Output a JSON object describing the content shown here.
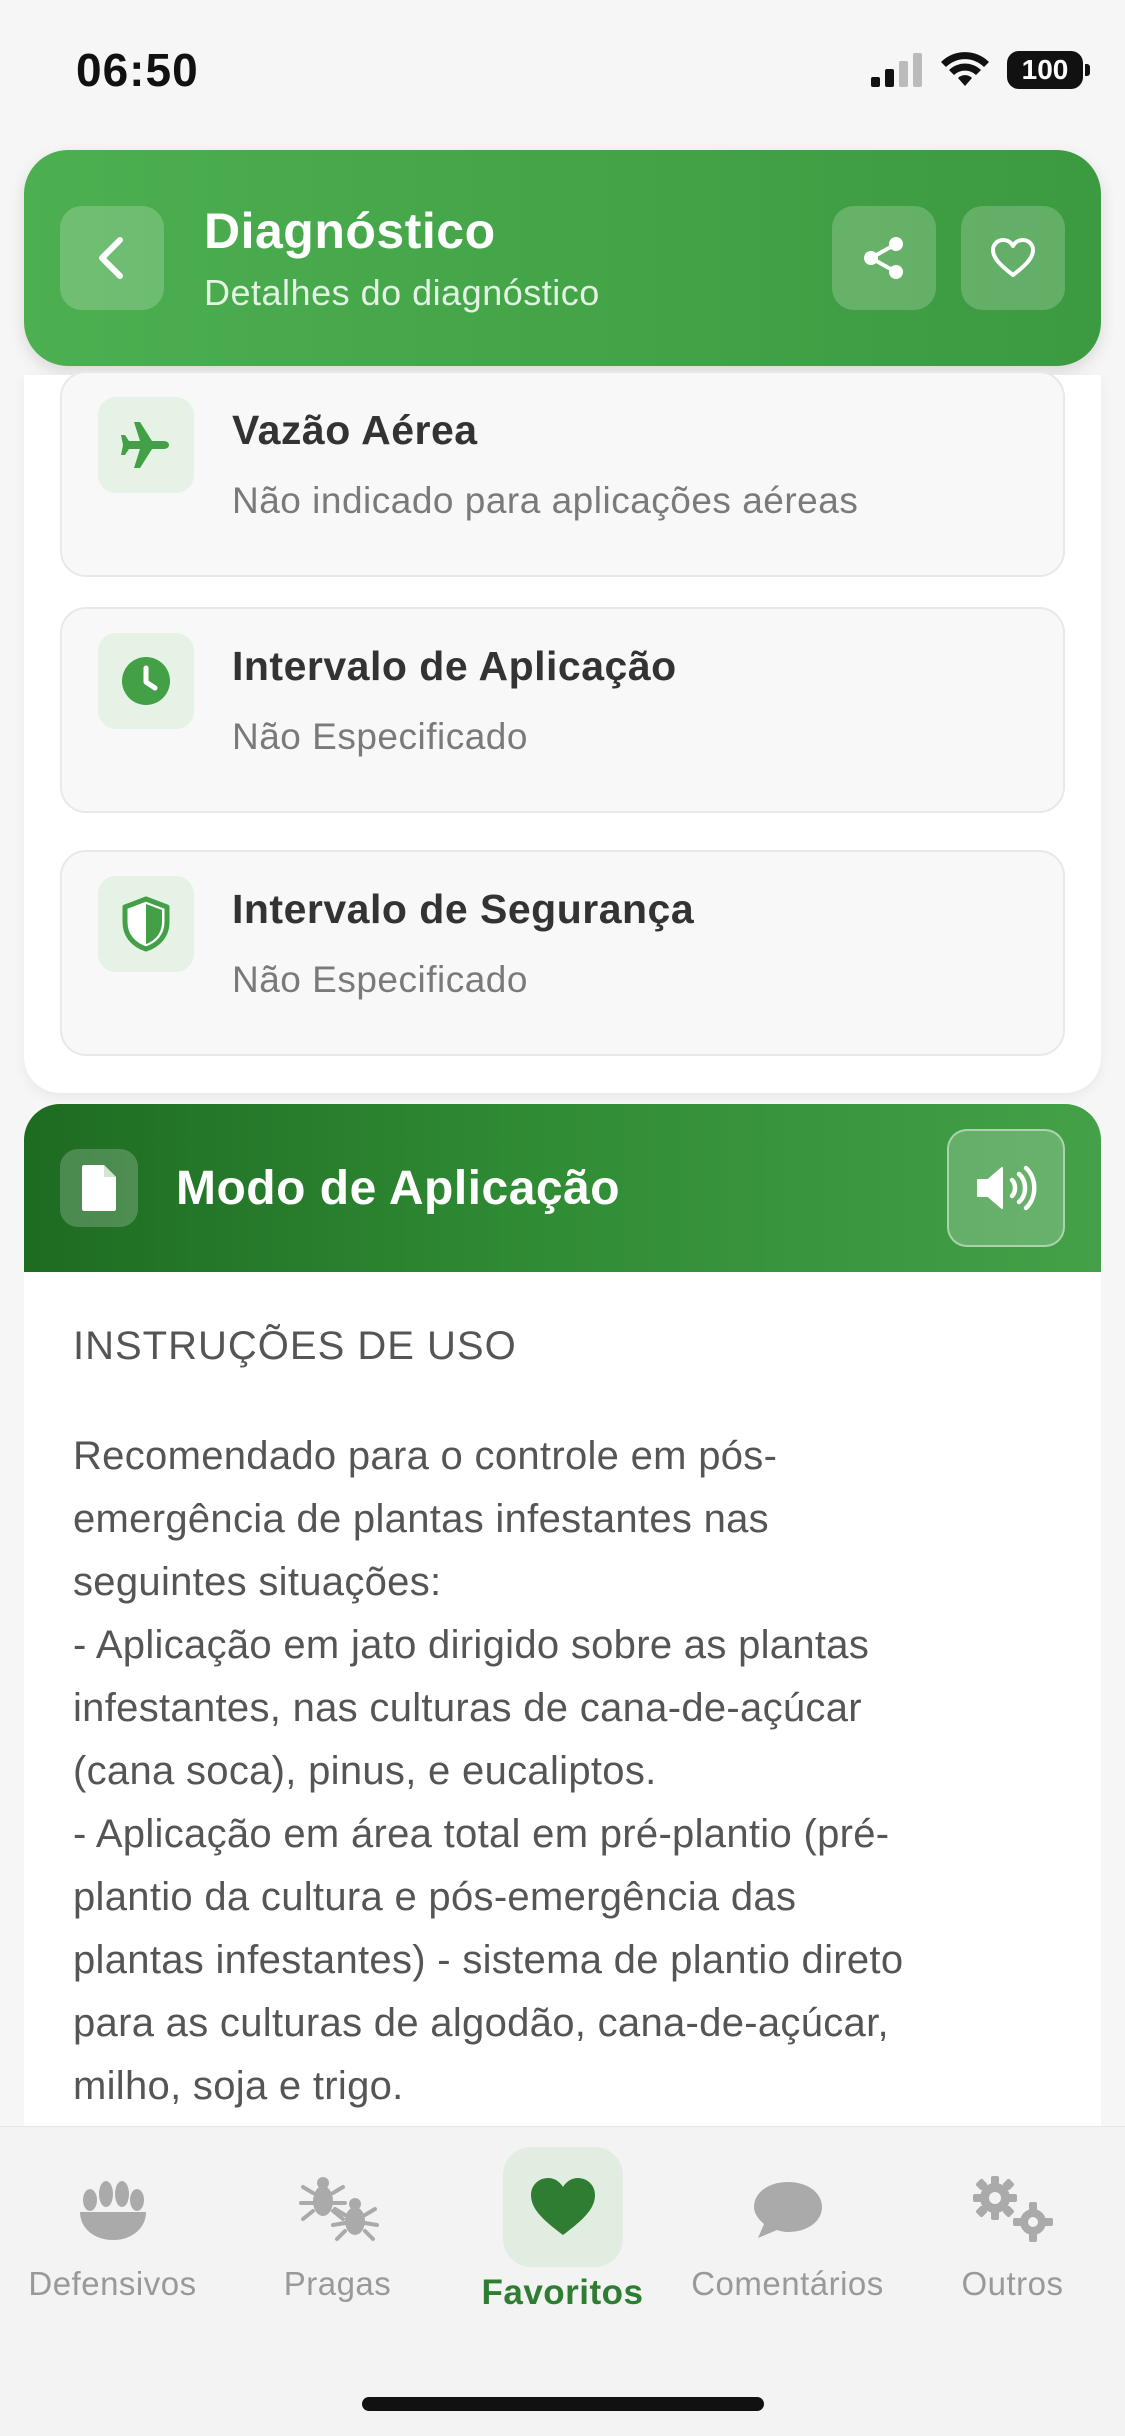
{
  "status_bar": {
    "time": "06:50",
    "battery": "100"
  },
  "header": {
    "title": "Diagnóstico",
    "subtitle": "Detalhes do diagnóstico"
  },
  "info_items": [
    {
      "title": "Vazão Aérea",
      "value": "Não indicado para aplicações aéreas",
      "icon": "airplane-icon"
    },
    {
      "title": "Intervalo de Aplicação",
      "value": "Não Especificado",
      "icon": "clock-icon"
    },
    {
      "title": "Intervalo de Segurança",
      "value": "Não Especificado",
      "icon": "shield-icon"
    }
  ],
  "modo": {
    "title": "Modo de Aplicação",
    "heading": "INSTRUÇÕES DE USO",
    "text": "Recomendado para o controle em pós-\nemergência de plantas infestantes nas\nseguintes situações:\n- Aplicação em jato dirigido sobre as plantas\ninfestantes, nas culturas de cana-de-açúcar\n(cana soca), pinus, e eucaliptos.\n- Aplicação em área total em pré-plantio (pré-\nplantio da cultura e pós-emergência das\nplantas infestantes) - sistema de plantio direto\npara as culturas de algodão, cana-de-açúcar,\nmilho, soja e trigo."
  },
  "nav": [
    {
      "label": "Defensivos",
      "icon": "plants-icon"
    },
    {
      "label": "Pragas",
      "icon": "bugs-icon"
    },
    {
      "label": "Favoritos",
      "icon": "heart-icon",
      "active": true
    },
    {
      "label": "Comentários",
      "icon": "comment-icon"
    },
    {
      "label": "Outros",
      "icon": "gears-icon"
    }
  ],
  "colors": {
    "primary": "#4caf50",
    "dark": "#1e6b22",
    "active": "#2e7d32"
  }
}
